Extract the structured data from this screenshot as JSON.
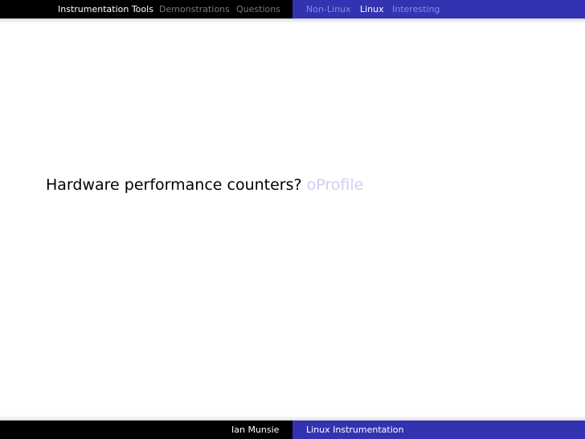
{
  "topbar": {
    "left_items": [
      {
        "label": "Instrumentation Tools",
        "active": true
      },
      {
        "label": "Demonstrations",
        "active": false
      },
      {
        "label": "Questions",
        "active": false
      }
    ],
    "right_items": [
      {
        "label": "Non-Linux",
        "active": false
      },
      {
        "label": "Linux",
        "active": true
      },
      {
        "label": "Interesting",
        "active": false
      }
    ]
  },
  "main": {
    "text": "Hardware performance counters?",
    "dim_text": "oProfile"
  },
  "footer": {
    "author": "Ian Munsie",
    "title": "Linux Instrumentation"
  },
  "colors": {
    "bar_dark": "#000000",
    "bar_blue": "#3333b2",
    "dim_text": "#cfcff0"
  }
}
